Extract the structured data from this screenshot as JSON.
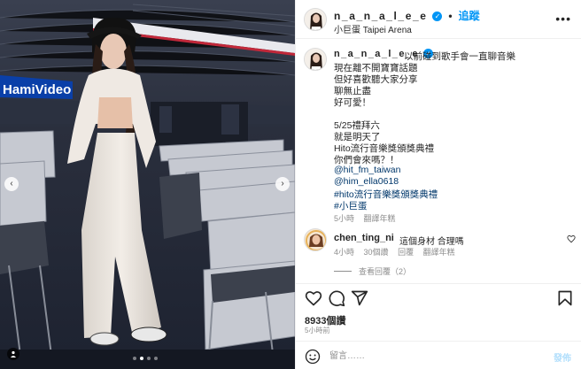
{
  "header": {
    "username": "n_a_n_a_l_e_e",
    "separator": "•",
    "follow_label": "追蹤",
    "location": "小巨蛋 Taipei Arena",
    "more_label": "•••"
  },
  "caption": {
    "username": "n_a_n_a_l_e_e",
    "lines": [
      "以前碰到歌手會一直聊音樂",
      "現在離不開寶寶話題",
      "但好喜歡聽大家分享",
      "聊無止盡",
      "好可愛！",
      "5/25禮拜六",
      "就是明天了",
      "Hito流行音樂獎頒獎典禮",
      "你們會來嗎？！"
    ],
    "mentions": [
      "@hit_fm_taiwan",
      "@him_ella0618"
    ],
    "hashtags": [
      "#hito流行音樂獎頒獎典禮",
      "#小巨蛋"
    ],
    "time": "5小時",
    "translate_label": "翻譯年糕"
  },
  "comment": {
    "username": "chen_ting_ni",
    "text": "這個身材 合理嗎",
    "time": "4小時",
    "likes": "30個讚",
    "reply_label": "回覆",
    "translate_label": "翻譯年糕",
    "view_replies": "查看回覆（2）"
  },
  "post": {
    "likes": "8933個讚",
    "ago": "5小時前"
  },
  "composer": {
    "placeholder": "留言……",
    "post_label": "發佈"
  },
  "media": {
    "slide_count": 4,
    "active_slide": 1,
    "banner_text": "HamiVideo"
  },
  "icons": {
    "verified": "verified-badge-icon",
    "more": "more-options-icon",
    "prev": "chevron-left-icon",
    "next": "chevron-right-icon",
    "like": "heart-icon",
    "comment": "comment-icon",
    "share": "send-icon",
    "save": "bookmark-icon",
    "emoji": "emoji-icon",
    "tag": "user-tag-icon"
  },
  "colors": {
    "accent": "#0095f6",
    "link": "#00376b",
    "muted": "#8e8e8e"
  }
}
